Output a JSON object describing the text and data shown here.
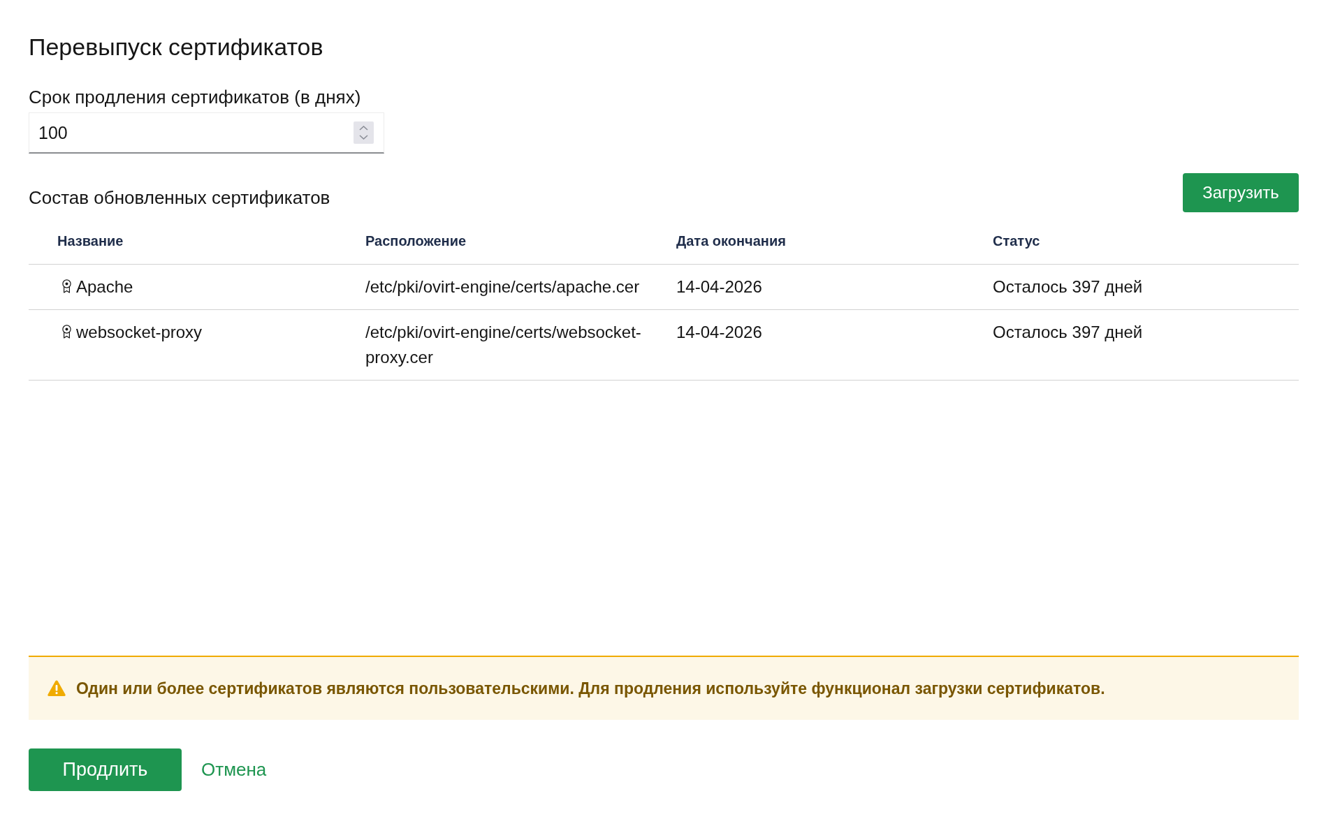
{
  "title": "Перевыпуск сертификатов",
  "renewal_period": {
    "label": "Срок продления сертификатов (в днях)",
    "value": "100"
  },
  "certificates": {
    "title": "Состав обновленных сертификатов",
    "upload_button": "Загрузить",
    "table": {
      "columns": [
        "Название",
        "Расположение",
        "Дата окончания",
        "Статус"
      ],
      "rows": [
        {
          "name": "Apache",
          "location": "/etc/pki/ovirt-engine/certs/apache.cer",
          "expires": "14-04-2026",
          "status": "Осталось 397 дней"
        },
        {
          "name": "websocket-proxy",
          "location": "/etc/pki/ovirt-engine/certs/websocket-proxy.cer",
          "expires": "14-04-2026",
          "status": "Осталось 397 дней"
        }
      ]
    }
  },
  "alert": {
    "kind": "warning",
    "text": "Один или более сертификатов являются пользовательскими. Для продления используйте функционал загрузки сертификатов."
  },
  "buttons": [
    {
      "label": "Продлить",
      "kind": "primary"
    },
    {
      "label": "Отмена",
      "kind": "link"
    }
  ]
}
